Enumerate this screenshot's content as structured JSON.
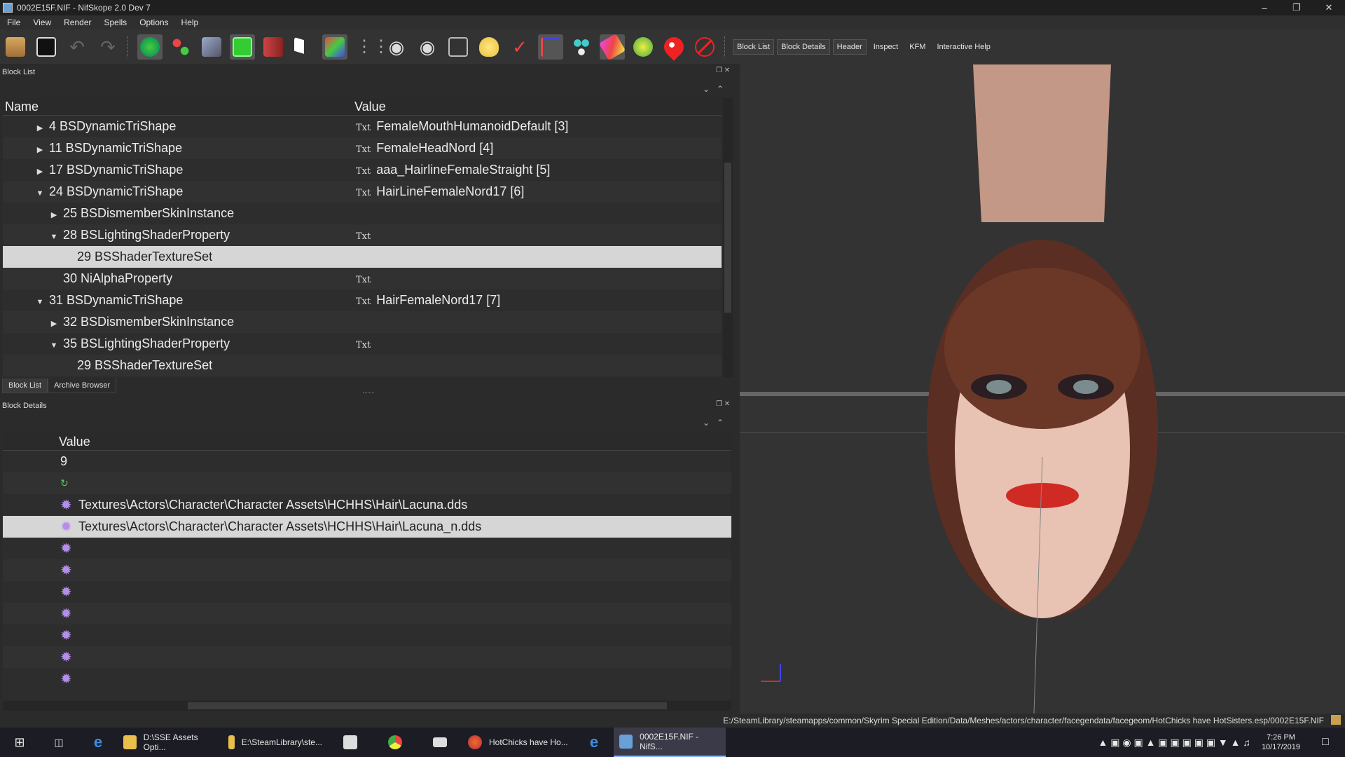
{
  "window": {
    "title": "0002E15F.NIF - NifSkope 2.0 Dev 7"
  },
  "menu": [
    "File",
    "View",
    "Render",
    "Spells",
    "Options",
    "Help"
  ],
  "toolbar_tabs": [
    "Block List",
    "Block Details",
    "Header",
    "Inspect",
    "KFM",
    "Interactive Help"
  ],
  "block_list": {
    "title": "Block List",
    "headers": {
      "name": "Name",
      "value": "Value"
    },
    "rows": [
      {
        "name": "4 BSDynamicTriShape",
        "value": "FemaleMouthHumanoidDefault [3]",
        "level": 0,
        "arrow": "▶",
        "txt": true
      },
      {
        "name": "11 BSDynamicTriShape",
        "value": "FemaleHeadNord [4]",
        "level": 0,
        "arrow": "▶",
        "txt": true
      },
      {
        "name": "17 BSDynamicTriShape",
        "value": "aaa_HairlineFemaleStraight [5]",
        "level": 0,
        "arrow": "▶",
        "txt": true
      },
      {
        "name": "24 BSDynamicTriShape",
        "value": "HairLineFemaleNord17 [6]",
        "level": 0,
        "arrow": "▼",
        "txt": true
      },
      {
        "name": "25 BSDismemberSkinInstance",
        "value": "",
        "level": 1,
        "arrow": "▶",
        "txt": false
      },
      {
        "name": "28 BSLightingShaderProperty",
        "value": "",
        "level": 1,
        "arrow": "▼",
        "txt": true
      },
      {
        "name": "29 BSShaderTextureSet",
        "value": "",
        "level": 2,
        "arrow": "",
        "txt": false
      },
      {
        "name": "30 NiAlphaProperty",
        "value": "",
        "level": 1,
        "arrow": "",
        "txt": true
      },
      {
        "name": "31 BSDynamicTriShape",
        "value": "HairFemaleNord17 [7]",
        "level": 0,
        "arrow": "▼",
        "txt": true
      },
      {
        "name": "32 BSDismemberSkinInstance",
        "value": "",
        "level": 1,
        "arrow": "▶",
        "txt": false
      },
      {
        "name": "35 BSLightingShaderProperty",
        "value": "",
        "level": 1,
        "arrow": "▼",
        "txt": true
      },
      {
        "name": "29 BSShaderTextureSet",
        "value": "",
        "level": 2,
        "arrow": "",
        "txt": false
      }
    ],
    "selected_index": 6,
    "txt_label": "Txt"
  },
  "bottom_tabs": [
    "Block List",
    "Archive Browser"
  ],
  "block_details": {
    "title": "Block Details",
    "header": "Value",
    "rows": [
      {
        "icon": "",
        "text": "9"
      },
      {
        "icon": "refresh",
        "text": ""
      },
      {
        "icon": "gear",
        "text": "Textures\\Actors\\Character\\Character Assets\\HCHHS\\Hair\\Lacuna.dds"
      },
      {
        "icon": "gear",
        "text": "Textures\\Actors\\Character\\Character Assets\\HCHHS\\Hair\\Lacuna_n.dds"
      },
      {
        "icon": "gear",
        "text": ""
      },
      {
        "icon": "gear",
        "text": ""
      },
      {
        "icon": "gear",
        "text": ""
      },
      {
        "icon": "gear",
        "text": ""
      },
      {
        "icon": "gear",
        "text": ""
      },
      {
        "icon": "gear",
        "text": ""
      },
      {
        "icon": "gear",
        "text": ""
      }
    ],
    "selected_index": 3
  },
  "status": {
    "path": "E:/SteamLibrary/steamapps/common/Skyrim Special Edition/Data/Meshes/actors/character/facegendata/facegeom/HotChicks have HotSisters.esp/0002E15F.NIF"
  },
  "taskbar": {
    "apps": [
      {
        "label": "D:\\SSE Assets Opti...",
        "color": "#e8c04a"
      },
      {
        "label": "E:\\SteamLibrary\\ste...",
        "color": "#e8c04a"
      },
      {
        "label": "HotChicks have Ho...",
        "color": "#e8702a"
      },
      {
        "label": "0002E15F.NIF - NifS...",
        "color": "#6aa0d8"
      }
    ],
    "time": "7:26 PM",
    "date": "10/17/2019"
  }
}
